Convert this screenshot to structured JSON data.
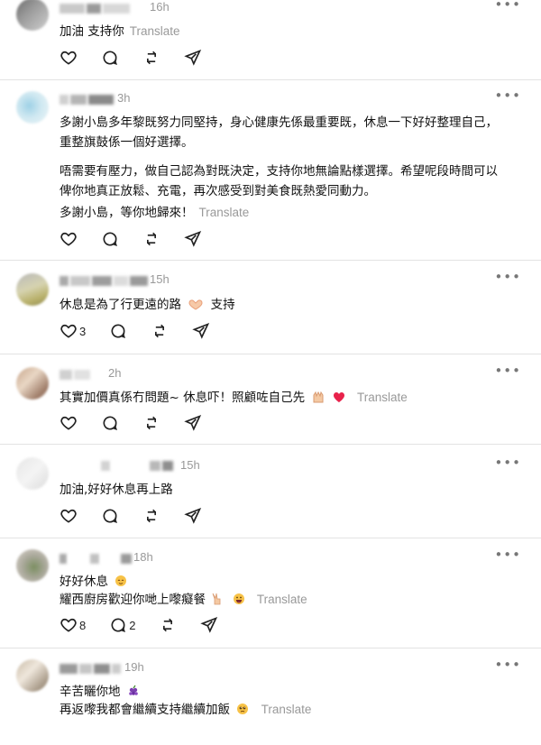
{
  "posts": [
    {
      "time": "16h",
      "lines": [
        "加油 支持你"
      ],
      "translate": "Translate",
      "likes": "",
      "replies": ""
    },
    {
      "time": "3h",
      "lines": [
        "多謝小島多年黎既努力同堅持，身心健康先係最重要既，休息一下好好整理自己，",
        "重整旗鼓係一個好選擇。",
        "唔需要有壓力，做自己認為對既決定，支持你地無論點樣選擇。希望呢段時間可以",
        "俾你地真正放鬆、充電，再次感受到對美食既熱愛同動力。",
        "多謝小島，等你地歸來！"
      ],
      "translate": "Translate",
      "likes": "",
      "replies": ""
    },
    {
      "time": "15h",
      "lines": [
        "休息是為了行更遠的路",
        "支持"
      ],
      "translate": "",
      "likes": "3",
      "replies": ""
    },
    {
      "time": "2h",
      "lines": [
        "其實加價真係冇問題~ 休息吓！照顧咗自己先"
      ],
      "translate": "Translate",
      "likes": "",
      "replies": ""
    },
    {
      "time": "15h",
      "lines": [
        "加油,好好休息再上路"
      ],
      "translate": "",
      "likes": "",
      "replies": ""
    },
    {
      "time": "18h",
      "lines": [
        "好好休息",
        "耀西廚房歡迎你哋上嚟癡餐"
      ],
      "translate": "Translate",
      "likes": "8",
      "replies": "2"
    },
    {
      "time": "19h",
      "lines": [
        "辛苦曬你地",
        "再返嚟我都會繼續支持繼續加飯"
      ],
      "translate": "Translate",
      "likes": "",
      "replies": ""
    }
  ],
  "icons": [
    "heart-icon",
    "reply-icon",
    "repost-icon",
    "share-icon",
    "more-icon"
  ]
}
